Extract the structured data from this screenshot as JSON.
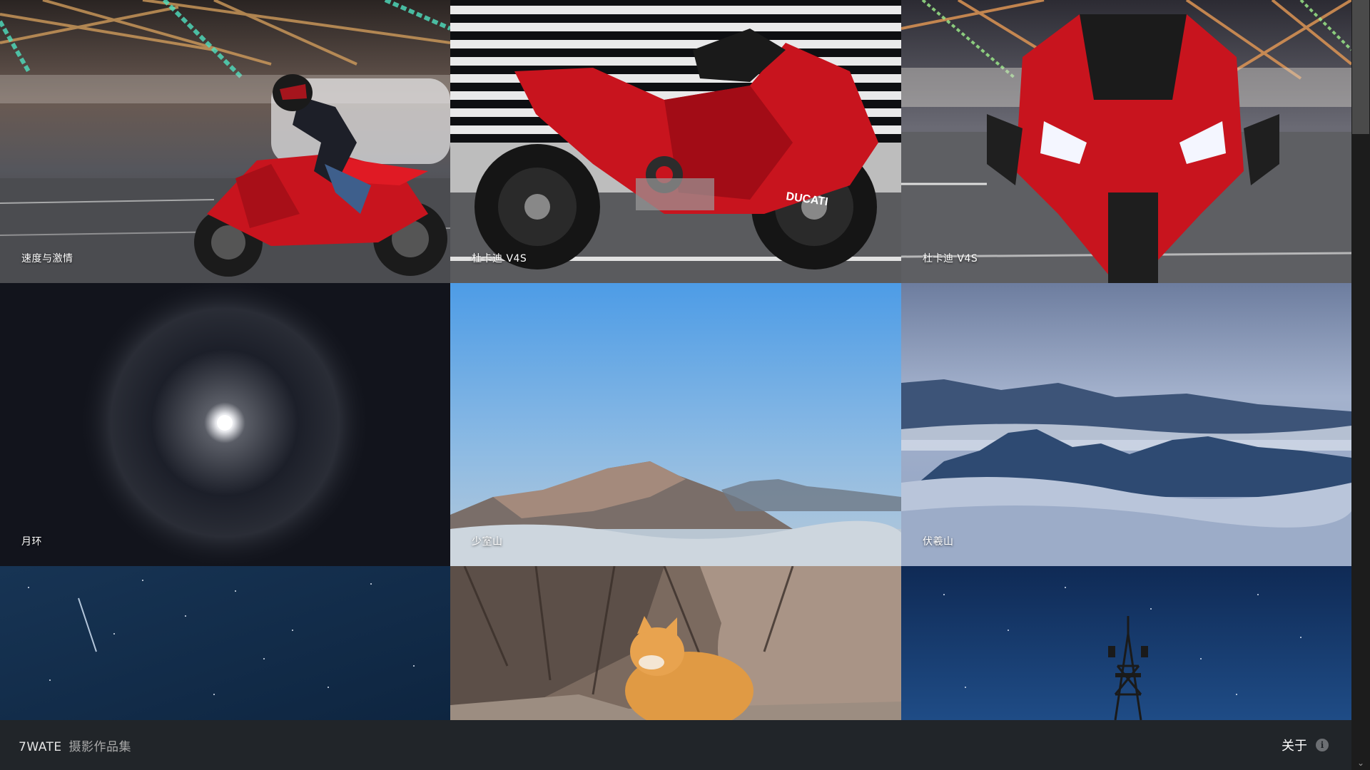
{
  "gallery": {
    "tiles": [
      {
        "caption": "速度与激情"
      },
      {
        "caption": "杜卡迪 V4S"
      },
      {
        "caption": "杜卡迪 V4S"
      },
      {
        "caption": "月环"
      },
      {
        "caption": "少室山"
      },
      {
        "caption": "伏羲山"
      },
      {
        "caption": ""
      },
      {
        "caption": ""
      },
      {
        "caption": ""
      }
    ]
  },
  "footer": {
    "brand_en": "7WATE",
    "brand_cn": "摄影作品集",
    "about_label": "关于",
    "about_icon": "info-icon"
  },
  "colors": {
    "footer_bg": "#212529",
    "ducati_red": "#c8141e"
  }
}
